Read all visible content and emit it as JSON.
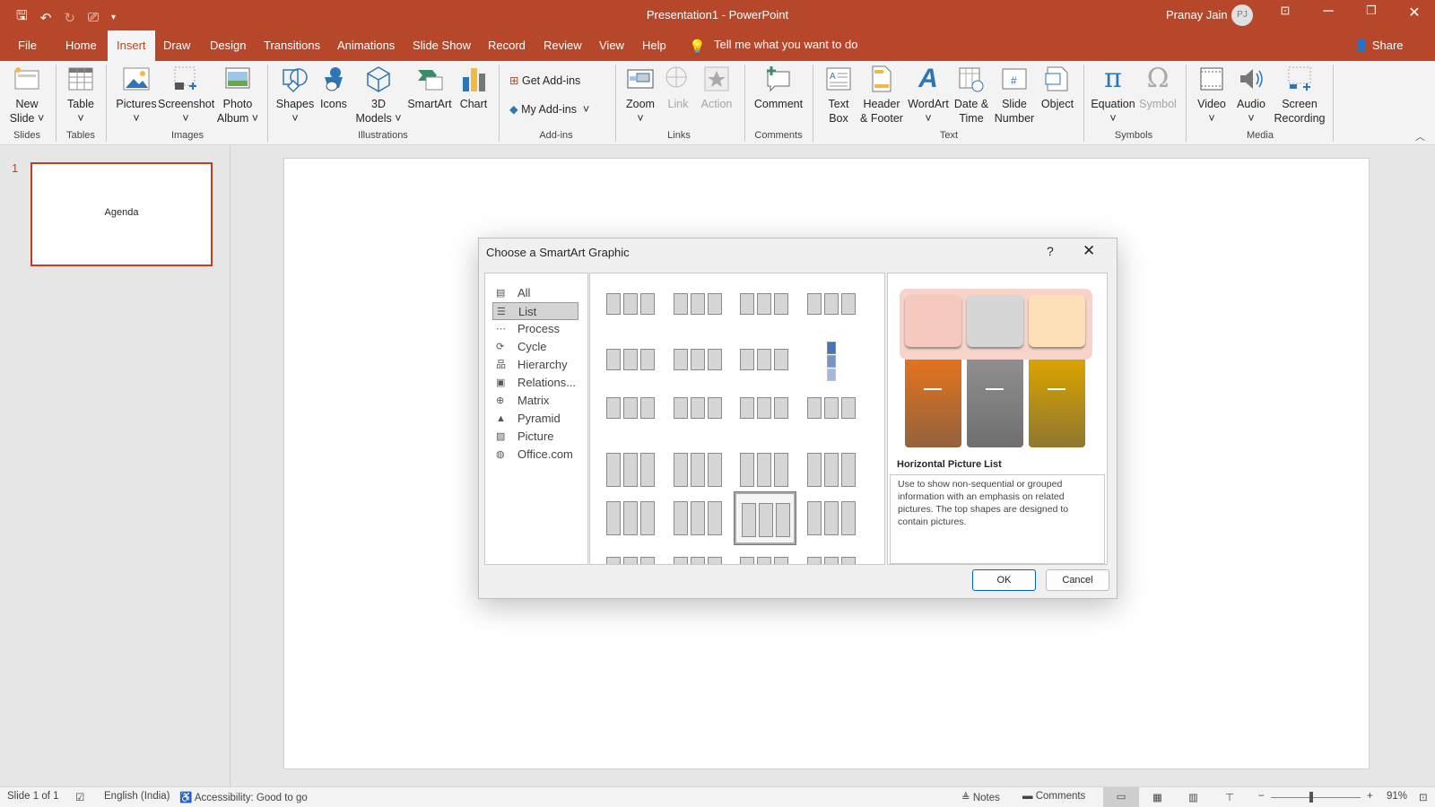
{
  "app": {
    "doc_title": "Presentation1  -  PowerPoint",
    "user_name": "Pranay Jain",
    "user_initials": "PJ",
    "theme_color": "#b7472a"
  },
  "qat": [
    "save-icon",
    "undo-icon",
    "redo-icon",
    "present-icon",
    "customize-icon"
  ],
  "tabs": [
    "File",
    "Home",
    "Insert",
    "Draw",
    "Design",
    "Transitions",
    "Animations",
    "Slide Show",
    "Record",
    "Review",
    "View",
    "Help"
  ],
  "active_tab": "Insert",
  "tell_me": "Tell me what you want to do",
  "share": "Share",
  "ribbon": {
    "buttons": [
      {
        "l1": "New",
        "l2": "Slide ˅"
      },
      {
        "l1": "Table",
        "l2": "˅"
      },
      {
        "l1": "Pictures",
        "l2": "˅"
      },
      {
        "l1": "Screenshot",
        "l2": "˅"
      },
      {
        "l1": "Photo",
        "l2": "Album ˅"
      },
      {
        "l1": "Shapes",
        "l2": "˅"
      },
      {
        "l1": "Icons",
        "l2": ""
      },
      {
        "l1": "3D",
        "l2": "Models ˅"
      },
      {
        "l1": "SmartArt",
        "l2": ""
      },
      {
        "l1": "Chart",
        "l2": ""
      },
      {
        "l1": "Get Add-ins",
        "l2": ""
      },
      {
        "l1": "My Add-ins",
        "l2": "˅"
      },
      {
        "l1": "Zoom",
        "l2": "˅"
      },
      {
        "l1": "Link",
        "l2": ""
      },
      {
        "l1": "Action",
        "l2": ""
      },
      {
        "l1": "Comment",
        "l2": ""
      },
      {
        "l1": "Text",
        "l2": "Box"
      },
      {
        "l1": "Header",
        "l2": "& Footer"
      },
      {
        "l1": "WordArt",
        "l2": "˅"
      },
      {
        "l1": "Date &",
        "l2": "Time"
      },
      {
        "l1": "Slide",
        "l2": "Number"
      },
      {
        "l1": "Object",
        "l2": ""
      },
      {
        "l1": "Equation",
        "l2": "˅"
      },
      {
        "l1": "Symbol",
        "l2": ""
      },
      {
        "l1": "Video",
        "l2": "˅"
      },
      {
        "l1": "Audio",
        "l2": "˅"
      },
      {
        "l1": "Screen",
        "l2": "Recording"
      }
    ],
    "groups": [
      "Slides",
      "Tables",
      "Images",
      "Illustrations",
      "Add-ins",
      "Links",
      "Comments",
      "Text",
      "Symbols",
      "Media"
    ]
  },
  "slides_pane": {
    "number": "1",
    "thumb_text": "Agenda"
  },
  "dialog": {
    "title": "Choose a SmartArt Graphic",
    "help": "?",
    "close": "✕",
    "categories": [
      "All",
      "List",
      "Process",
      "Cycle",
      "Hierarchy",
      "Relations...",
      "Matrix",
      "Pyramid",
      "Picture",
      "Office.com"
    ],
    "selected_category": "List",
    "preview_name": "Horizontal Picture List",
    "preview_desc": "Use to show non-sequential or grouped information with an emphasis on related pictures. The top shapes are designed to contain pictures.",
    "preview_colors": {
      "top": [
        "#f5c9bd",
        "#d6d6d6",
        "#fde0b8"
      ],
      "bottom": [
        "#e2731f",
        "#8f8f8f",
        "#d9a300"
      ]
    },
    "ok": "OK",
    "cancel": "Cancel"
  },
  "status": {
    "slide": "Slide 1 of 1",
    "language": "English (India)",
    "accessibility": "Accessibility: Good to go",
    "notes": "Notes",
    "comments": "Comments",
    "zoom": "91%",
    "zoom_level_percent": 91
  }
}
